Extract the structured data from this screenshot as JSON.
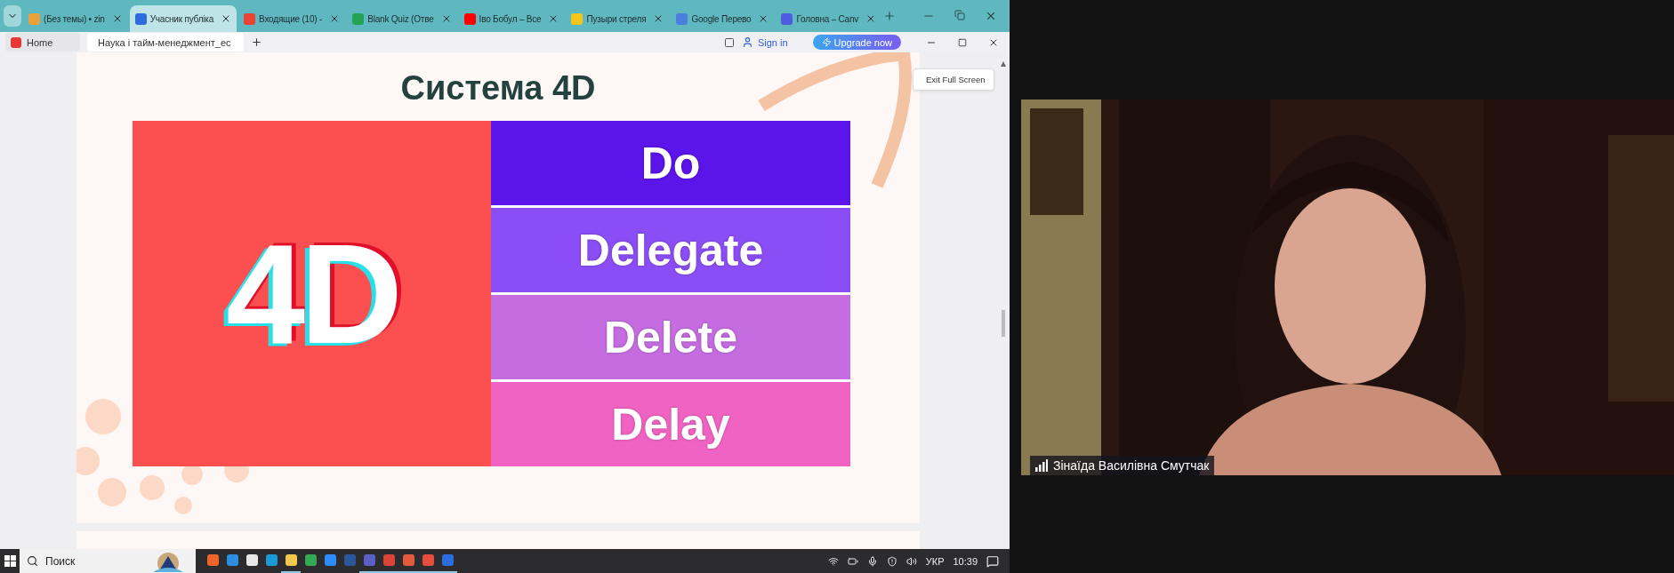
{
  "browser": {
    "tabs": [
      {
        "label": "(Без темы) • zin",
        "selected": false,
        "color": "#e9a23b"
      },
      {
        "label": "Учасник публіка",
        "selected": true,
        "color": "#2d6cdf"
      },
      {
        "label": "Входящие (10) -",
        "selected": false,
        "color": "#ea4335"
      },
      {
        "label": "Blank Quiz (Отве",
        "selected": false,
        "color": "#23a455"
      },
      {
        "label": "Іво Бобул – Все",
        "selected": false,
        "color": "#ff0000"
      },
      {
        "label": "Пузыри стреля",
        "selected": false,
        "color": "#f5c518"
      },
      {
        "label": "Google Перево",
        "selected": false,
        "color": "#4a7fe0"
      },
      {
        "label": "Головна – Canv",
        "selected": false,
        "color": "#4c5de0"
      }
    ]
  },
  "app_bar": {
    "home": "Home",
    "doc_tab": "Наука і тайм-менеджмент_ес",
    "sign_in": "Sign in",
    "upgrade": "Upgrade now"
  },
  "slide": {
    "title": "Система 4D",
    "logo_text": "4D",
    "items": [
      {
        "label": "Do",
        "color": "#5b14ea"
      },
      {
        "label": "Delegate",
        "color": "#8b4ef6"
      },
      {
        "label": "Delete",
        "color": "#c56ce1"
      },
      {
        "label": "Delay",
        "color": "#f163c3"
      }
    ]
  },
  "tooltip": "Exit Full Screen",
  "taskbar": {
    "search": "Поиск",
    "apps": [
      {
        "color": "#f0642a",
        "running": false
      },
      {
        "color": "#2b8ee0",
        "running": false
      },
      {
        "color": "#e8e8e8",
        "running": false
      },
      {
        "color": "#1c9ad6",
        "running": false
      },
      {
        "color": "#f2c94c",
        "running": true
      },
      {
        "color": "#34a853",
        "running": false
      },
      {
        "color": "#2d8cff",
        "running": false
      },
      {
        "color": "#2b579a",
        "running": false
      },
      {
        "color": "#5b5fc7",
        "running": true
      },
      {
        "color": "#db4437",
        "running": true
      },
      {
        "color": "#e45a3c",
        "running": true
      },
      {
        "color": "#e74c3c",
        "running": true
      },
      {
        "color": "#2d6cdf",
        "running": true
      }
    ],
    "language": "УКР",
    "time": "10:39"
  },
  "video": {
    "participant": "Зінаїда Василівна Смутчак"
  }
}
